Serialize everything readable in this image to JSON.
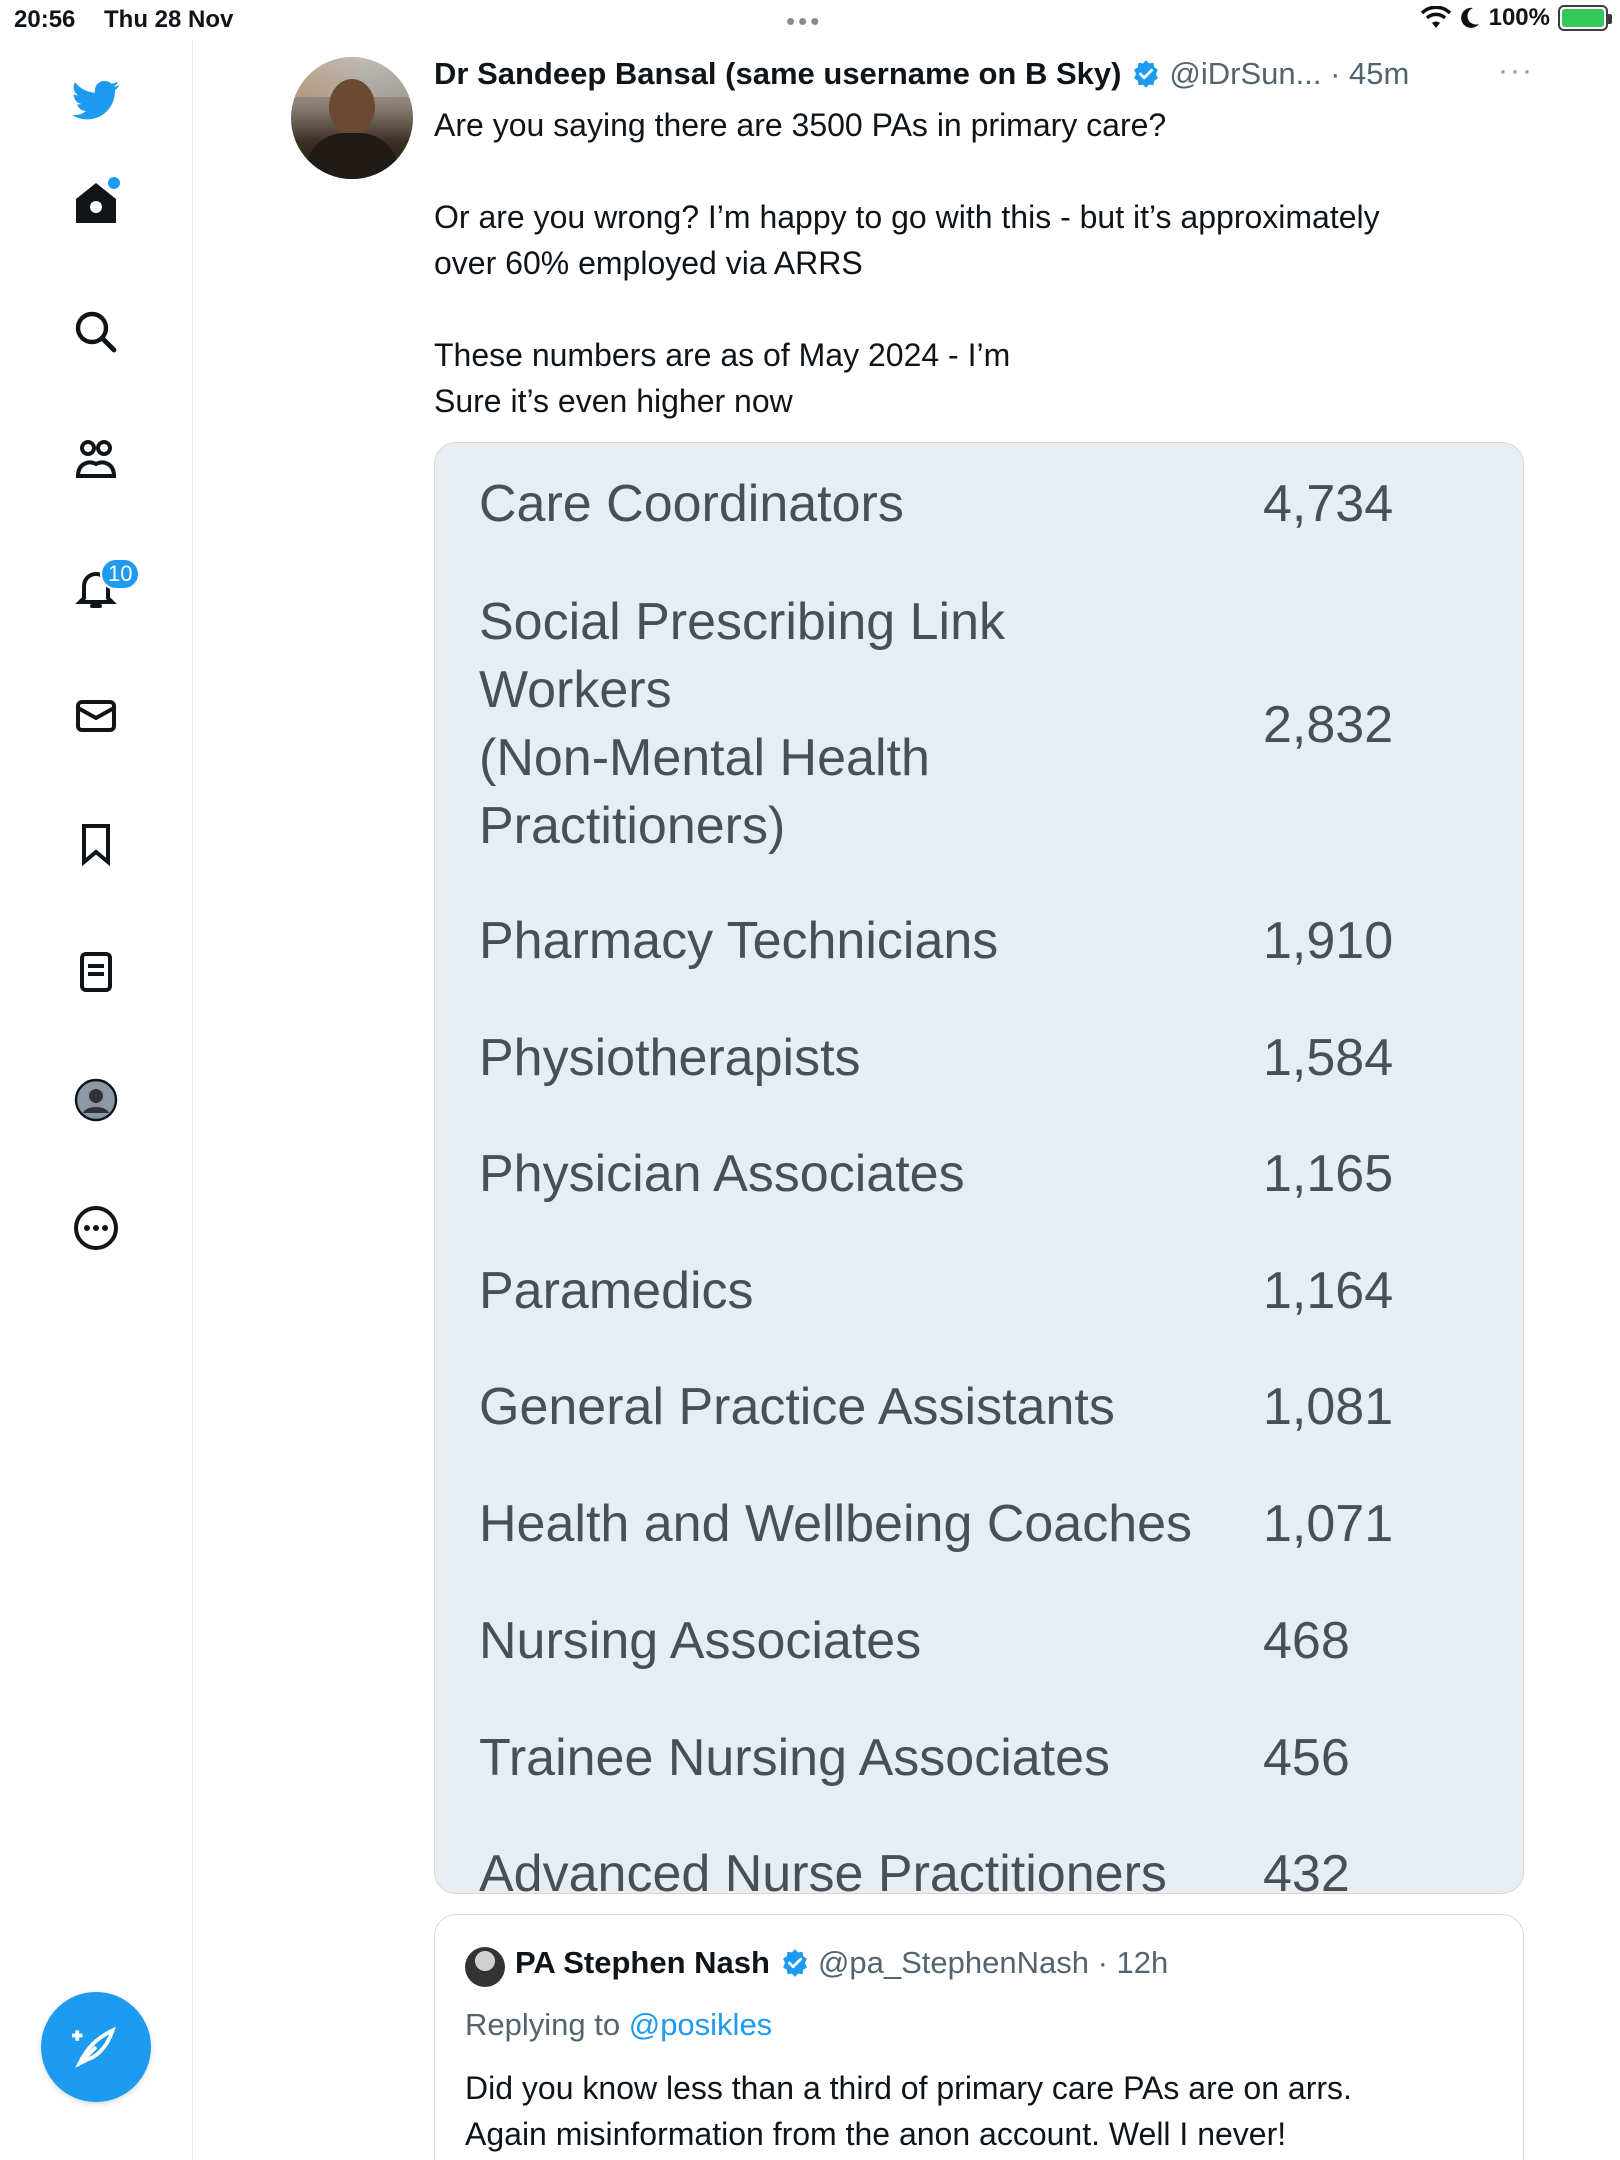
{
  "status_bar": {
    "time": "20:56",
    "date": "Thu 28 Nov",
    "battery": "100%"
  },
  "sidebar": {
    "notifications_badge": "10",
    "accent_color": "#1d9bf0"
  },
  "tweet": {
    "author_name": "Dr Sandeep Bansal (same username on B Sky)",
    "handle_time": "@iDrSun... · 45m",
    "lines": [
      "Are you saying there are 3500 PAs in primary care?",
      "",
      "Or are you wrong? I’m happy to go with this - but it’s approximately",
      "over 60% employed via ARRS",
      "",
      "These numbers are as of May 2024 - I’m",
      "Sure it’s even higher now"
    ]
  },
  "media": {
    "rows": [
      {
        "label": "Care Coordinators",
        "value": "4,734"
      },
      {
        "label": "Social Prescribing Link\nWorkers\n (Non-Mental Health\nPractitioners)",
        "value": "2,832"
      },
      {
        "label": "Pharmacy Technicians",
        "value": "1,910"
      },
      {
        "label": "Physiotherapists",
        "value": "1,584"
      },
      {
        "label": "Physician Associates",
        "value": "1,165"
      },
      {
        "label": "Paramedics",
        "value": "1,164"
      },
      {
        "label": "General Practice Assistants",
        "value": "1,081"
      },
      {
        "label": "Health and Wellbeing Coaches",
        "value": "1,071"
      },
      {
        "label": "Nursing Associates",
        "value": "468"
      },
      {
        "label": "Trainee Nursing Associates",
        "value": "456"
      },
      {
        "label": "Advanced Nurse Practitioners",
        "value": "432"
      }
    ]
  },
  "quote": {
    "author_name": "PA Stephen Nash",
    "handle_time": "@pa_StephenNash · 12h",
    "replying_prefix": "Replying to",
    "replying_to": "@posikles",
    "lines": [
      "Did you know less than a third of primary care PAs are on arrs.",
      "Again misinformation from the anon account. Well I never!"
    ]
  }
}
